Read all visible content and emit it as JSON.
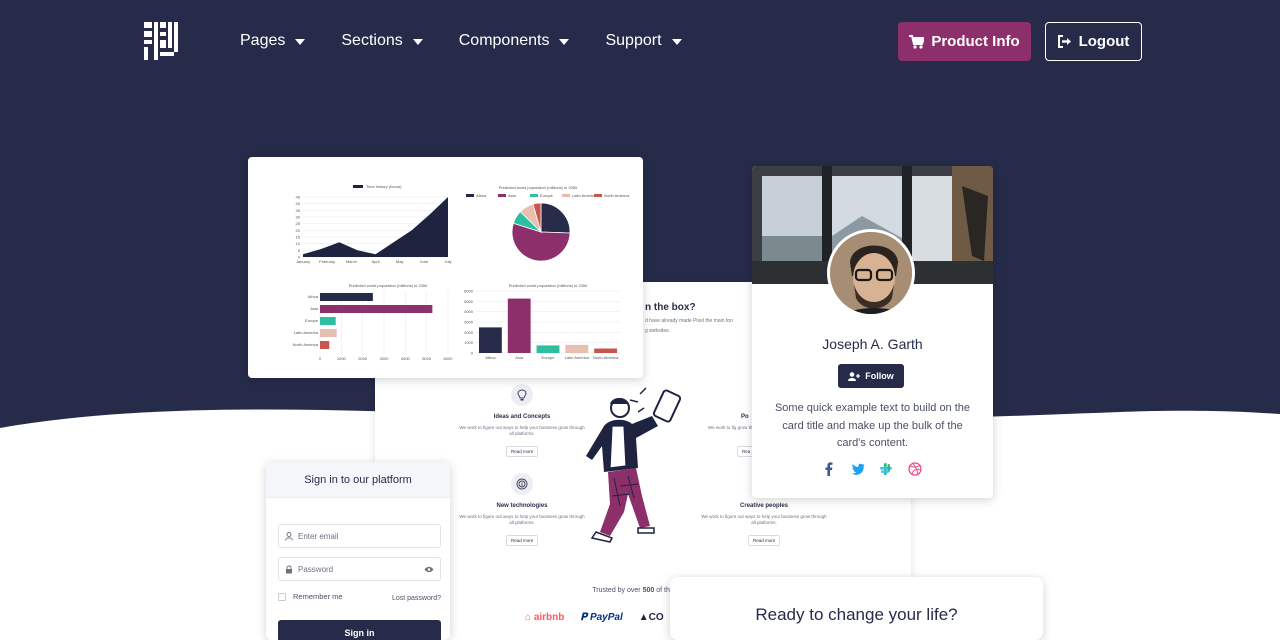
{
  "nav": {
    "menu": [
      {
        "label": "Pages"
      },
      {
        "label": "Sections"
      },
      {
        "label": "Components"
      },
      {
        "label": "Support"
      }
    ],
    "product_button": "Product Info",
    "logout_button": "Logout"
  },
  "colors": {
    "hero_bg": "#262b4a",
    "accent": "#8c2f6b",
    "teal": "#2fbfa0"
  },
  "charts_card": {
    "chart_data": [
      {
        "type": "area",
        "series": [
          {
            "name": "Time history (hours)",
            "values": [
              2,
              6,
              11,
              5,
              2,
              11,
              20,
              32,
              45
            ]
          }
        ],
        "categories": [
          "January",
          "February",
          "March",
          "April",
          "May",
          "June",
          "July"
        ],
        "ylim": [
          0,
          45
        ]
      },
      {
        "type": "pie",
        "title": "Predicted world population (millions) in 2050",
        "categories": [
          "Africa",
          "Asia",
          "Europe",
          "Latin America",
          "North America"
        ],
        "values": [
          2478,
          5267,
          734,
          784,
          433
        ]
      },
      {
        "type": "bar",
        "title": "Predicted world population (millions) in 2050",
        "categories": [
          "Africa",
          "Asia",
          "Europe",
          "Latin America",
          "North America"
        ],
        "values": [
          2478,
          5267,
          734,
          784,
          433
        ]
      },
      {
        "type": "bar",
        "title": "Predicted world population (millions) in 2050",
        "categories": [
          "Africa",
          "Asia",
          "Europe",
          "Latin America",
          "North America"
        ],
        "values": [
          2478,
          5267,
          734,
          784,
          433
        ]
      }
    ]
  },
  "landing": {
    "heading_fragment": "n the box?",
    "text_fragment_1": "d have already made Pixel the main too",
    "text_fragment_2": "g websites.",
    "features": [
      {
        "title": "Ideas and Concepts",
        "text": "We work to figure out ways to help your business grow through all platforms.",
        "button": "Read more"
      },
      {
        "title": "New technologies",
        "text": "We work to figure out ways to help your business grow through all platforms.",
        "button": "Read more"
      },
      {
        "title": "Creative peoples",
        "text": "We work to figure out ways to help your business grow through all platforms.",
        "button": "Read more"
      },
      {
        "title": "Po",
        "text": "We work to fig grow th",
        "button": "Rea"
      }
    ],
    "trusted_prefix": "Trusted by over ",
    "trusted_count": "500",
    "trusted_suffix": " of the world'",
    "brands": [
      "airbnb",
      "PayPal",
      "CO"
    ]
  },
  "profile": {
    "name": "Joseph A. Garth",
    "follow": "Follow",
    "text": "Some quick example text to build on the card title and make up the bulk of the card's content."
  },
  "signin": {
    "title": "Sign in to our platform",
    "email_placeholder": "Enter email",
    "password_placeholder": "Password",
    "remember": "Remember me",
    "lost": "Lost password?",
    "button": "Sign in"
  },
  "cta": {
    "title": "Ready to change your life?"
  }
}
